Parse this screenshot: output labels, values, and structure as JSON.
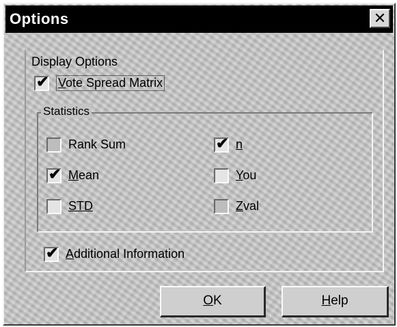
{
  "dialog": {
    "title": "Options",
    "close_glyph": "✕"
  },
  "display_options": {
    "label": "Display Options",
    "vote_spread_matrix": {
      "hotkey": "V",
      "rest": "ote Spread Matrix",
      "checked": true
    }
  },
  "statistics": {
    "label": "Statistics",
    "rank_sum": {
      "text": "Rank Sum",
      "checked": false,
      "disabled": true
    },
    "mean": {
      "hotkey": "M",
      "rest": "ean",
      "checked": true
    },
    "std": {
      "text": "STD",
      "checked": false
    },
    "n": {
      "text": "n",
      "checked": true
    },
    "you": {
      "hotkey": "Y",
      "rest": "ou",
      "checked": false
    },
    "zval": {
      "hotkey": "Z",
      "rest": "val",
      "checked": false,
      "disabled": true
    }
  },
  "additional_information": {
    "hotkey": "A",
    "rest": "dditional Information",
    "checked": true
  },
  "buttons": {
    "ok": {
      "hotkey": "O",
      "rest": "K"
    },
    "help": {
      "hotkey": "H",
      "rest": "elp"
    }
  },
  "check_glyph": "✔"
}
